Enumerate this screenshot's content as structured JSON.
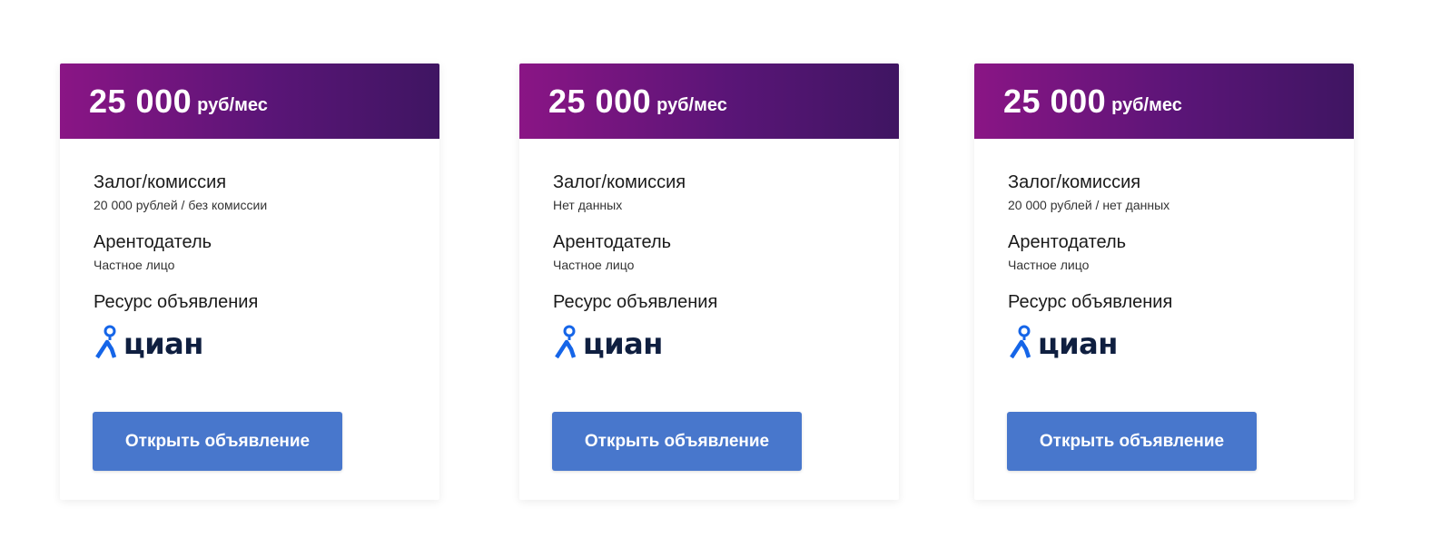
{
  "listings": [
    {
      "price_amount": "25 000",
      "price_unit": "руб/мес",
      "deposit_label": "Залог/комиссия",
      "deposit_value": "20 000 рублей / без комиссии",
      "landlord_label": "Арентодатель",
      "landlord_value": "Частное лицо",
      "source_label": "Ресурс объявления",
      "source_name": "циан",
      "open_button_label": "Открыть объявление"
    },
    {
      "price_amount": "25 000",
      "price_unit": "руб/мес",
      "deposit_label": "Залог/комиссия",
      "deposit_value": "Нет данных",
      "landlord_label": "Арентодатель",
      "landlord_value": "Частное лицо",
      "source_label": "Ресурс объявления",
      "source_name": "циан",
      "open_button_label": "Открыть объявление"
    },
    {
      "price_amount": "25 000",
      "price_unit": "руб/мес",
      "deposit_label": "Залог/комиссия",
      "deposit_value": "20 000 рублей / нет данных",
      "landlord_label": "Арентодатель",
      "landlord_value": "Частное лицо",
      "source_label": "Ресурс объявления",
      "source_name": "циан",
      "open_button_label": "Открыть объявление"
    }
  ],
  "colors": {
    "header_gradient_start": "#8a1585",
    "header_gradient_end": "#3f1562",
    "button_bg": "#4877cc",
    "logo_blue": "#1565e8",
    "logo_text": "#0f1f40"
  },
  "icons": {
    "source_logo": "cian-logo-icon"
  }
}
